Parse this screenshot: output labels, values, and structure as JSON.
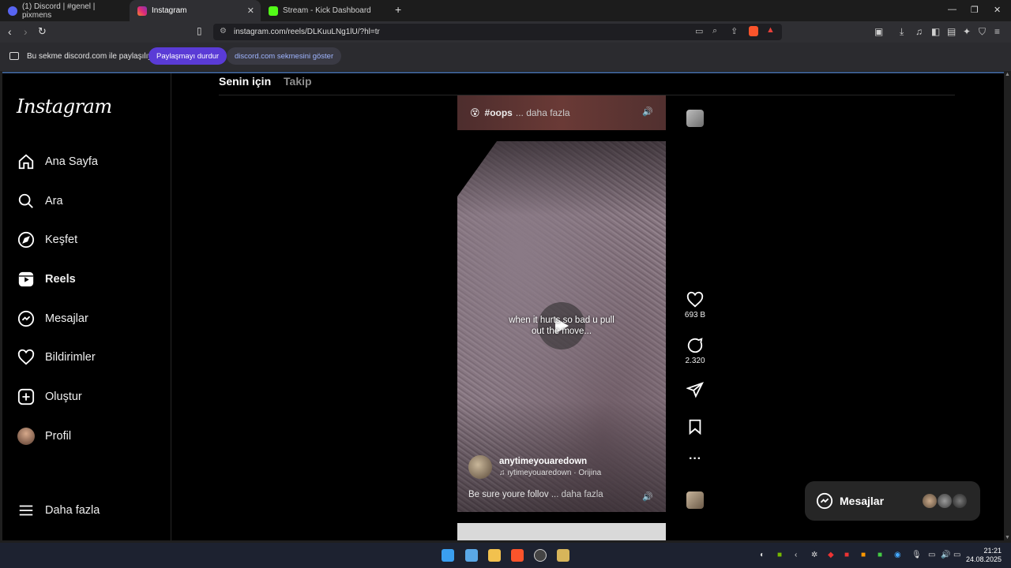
{
  "browser": {
    "tabs": [
      {
        "title": "(1) Discord | #genel | pixmens",
        "active": false
      },
      {
        "title": "Instagram",
        "active": true
      },
      {
        "title": "Stream - Kick Dashboard",
        "active": false
      }
    ],
    "url": "instagram.com/reels/DLKuuLNg1lU/?hl=tr"
  },
  "sharebar": {
    "message": "Bu sekme discord.com ile paylaşılıyor",
    "stop_label": "Paylaşmayı durdur",
    "show_label": "discord.com sekmesini göster"
  },
  "sidebar": {
    "logo": "Instagram",
    "items": [
      {
        "label": "Ana Sayfa",
        "icon": "home-icon"
      },
      {
        "label": "Ara",
        "icon": "search-icon"
      },
      {
        "label": "Keşfet",
        "icon": "compass-icon"
      },
      {
        "label": "Reels",
        "icon": "reels-icon"
      },
      {
        "label": "Mesajlar",
        "icon": "messenger-icon"
      },
      {
        "label": "Bildirimler",
        "icon": "heart-icon"
      },
      {
        "label": "Oluştur",
        "icon": "plus-icon"
      },
      {
        "label": "Profil",
        "icon": "avatar"
      }
    ],
    "more": "Daha fazla"
  },
  "feed": {
    "tab_foryou": "Senin için",
    "tab_following": "Takip"
  },
  "reel_prev": {
    "hashtag": "#oops",
    "more": "... daha fazla"
  },
  "reel": {
    "caption_line1": "when it hurts so bad u pull",
    "caption_line2": "out the move...",
    "username": "anytimeyouaredown",
    "audio": "ıytimeyouaredown · Orijina",
    "description": "Be sure youre follov",
    "desc_more": "... daha fazla",
    "likes": "693 B",
    "comments": "2.320"
  },
  "messages": {
    "label": "Mesajlar"
  },
  "clock": {
    "time": "21:21",
    "date": "24.08.2025"
  }
}
